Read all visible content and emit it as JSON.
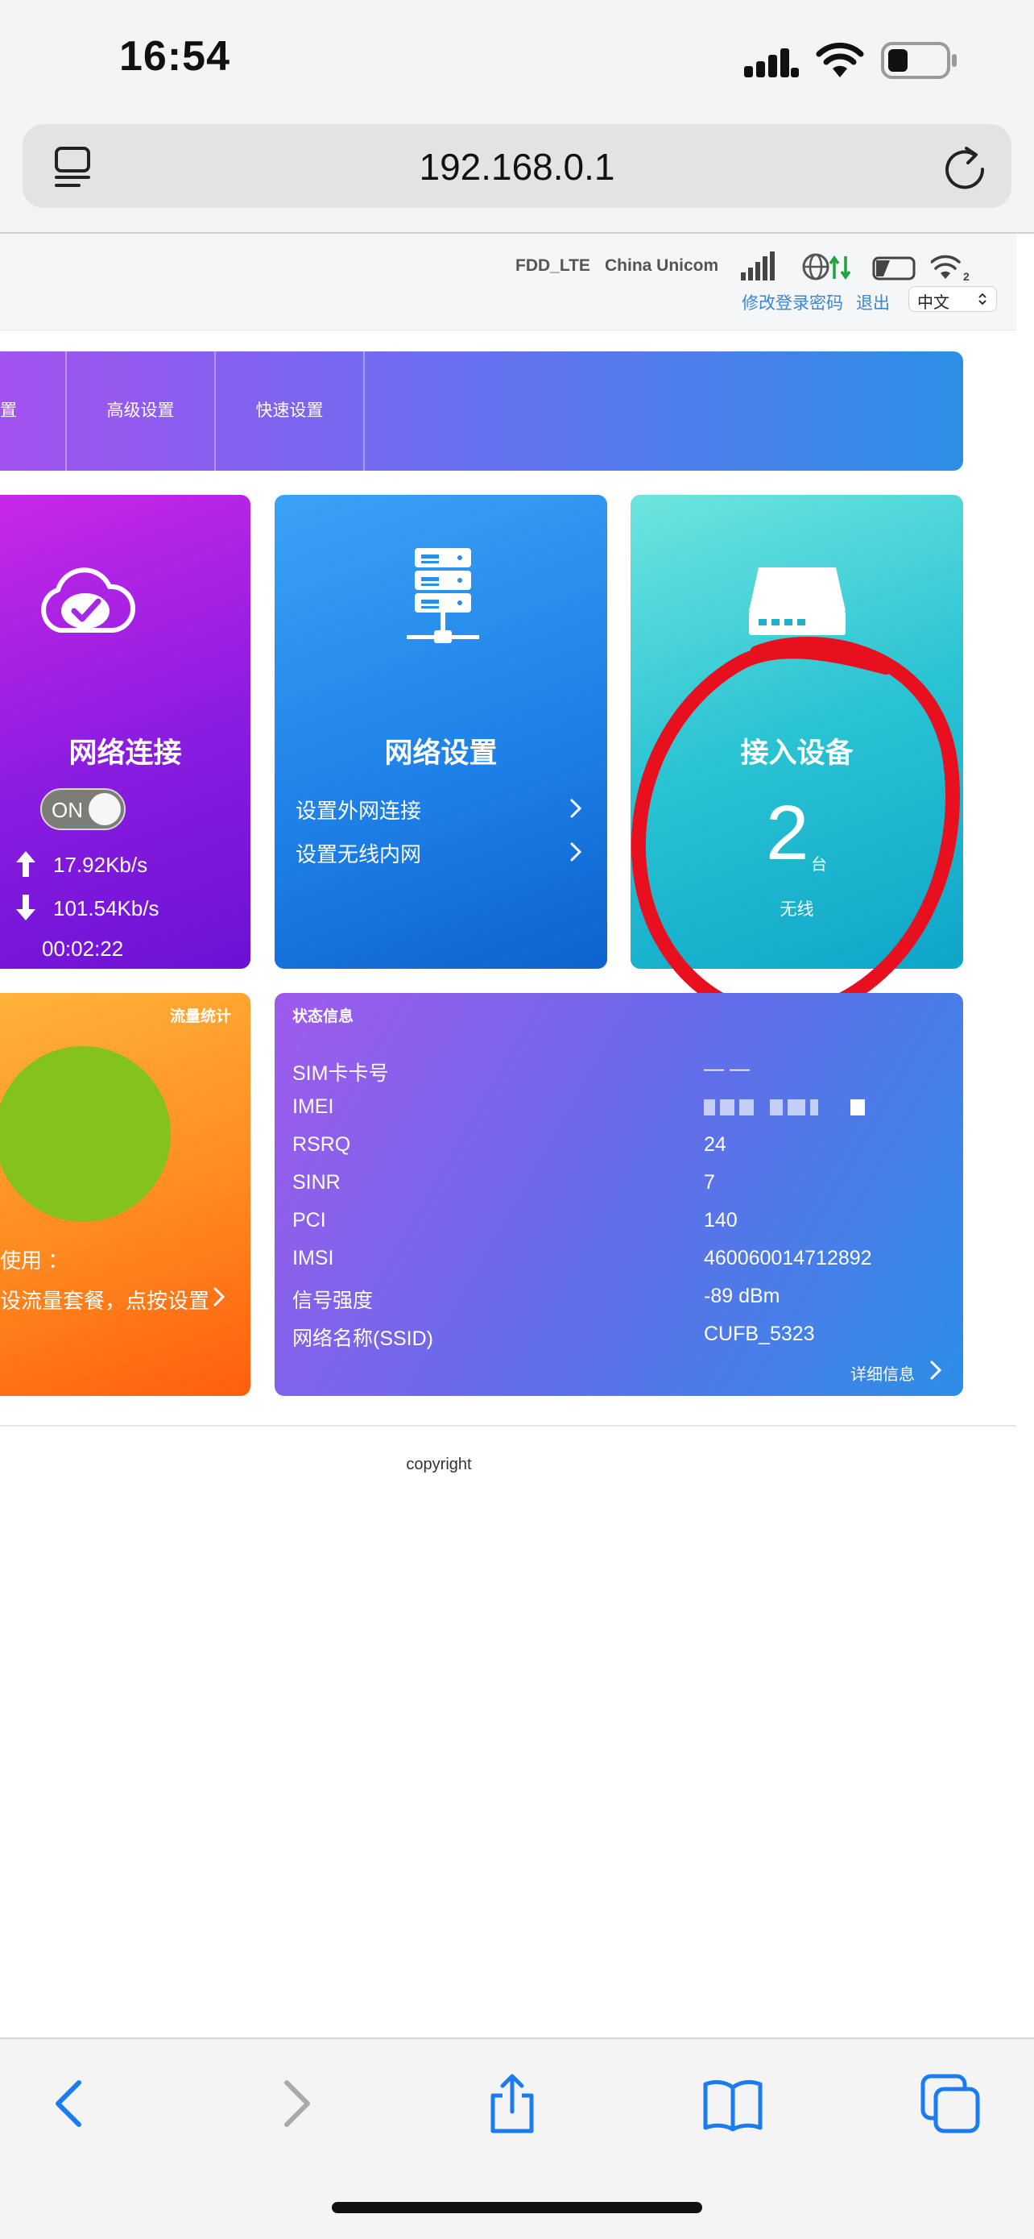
{
  "status_bar": {
    "time": "16:54",
    "icons": [
      "cellular-signal-icon",
      "wifi-icon",
      "battery-icon"
    ]
  },
  "browser": {
    "url": "192.168.0.1",
    "icons": [
      "reader-icon",
      "reload-icon"
    ]
  },
  "router_header": {
    "network_mode": "FDD_LTE",
    "carrier": "China Unicom",
    "change_password": "修改登录密码",
    "logout": "退出",
    "language": "中文",
    "icons": [
      "signal-bars-icon",
      "globe-data-icon",
      "sim-icon",
      "wifi-clients-icon"
    ],
    "wifi_clients": "2"
  },
  "nav": {
    "items": [
      {
        "label": "置"
      },
      {
        "label": "高级设置"
      },
      {
        "label": "快速设置"
      }
    ]
  },
  "cards": {
    "connection": {
      "title": "网络连接",
      "toggle": "ON",
      "upload_rate": "17.92Kb/s",
      "download_rate": "101.54Kb/s",
      "uptime": "00:02:22"
    },
    "network_settings": {
      "title": "网络设置",
      "links": [
        "设置外网连接",
        "设置无线内网"
      ]
    },
    "devices": {
      "title": "接入设备",
      "count": "2",
      "unit": "台",
      "type": "无线"
    },
    "traffic": {
      "title": "流量统计",
      "used_label": "使用  ：",
      "set_plan": "设流量套餐，点按设置"
    },
    "status": {
      "title": "状态信息",
      "rows": [
        {
          "key": "SIM卡卡号",
          "value": "— —"
        },
        {
          "key": "IMEI",
          "value": ""
        },
        {
          "key": "RSRQ",
          "value": "24"
        },
        {
          "key": "SINR",
          "value": "7"
        },
        {
          "key": "PCI",
          "value": "140"
        },
        {
          "key": "IMSI",
          "value": "460060014712892"
        },
        {
          "key": "信号强度",
          "value": "-89 dBm"
        },
        {
          "key": "网络名称(SSID)",
          "value": "CUFB_5323"
        }
      ],
      "detail_link": "详细信息"
    }
  },
  "footer": {
    "copyright": "copyright"
  },
  "toolbar": {
    "icons": [
      "back-icon",
      "forward-icon",
      "share-icon",
      "bookmarks-icon",
      "tabs-icon"
    ]
  },
  "colors": {
    "accent_link": "#3a86d6",
    "annotation_red": "#e8101e",
    "pie_green": "#86c21c"
  }
}
